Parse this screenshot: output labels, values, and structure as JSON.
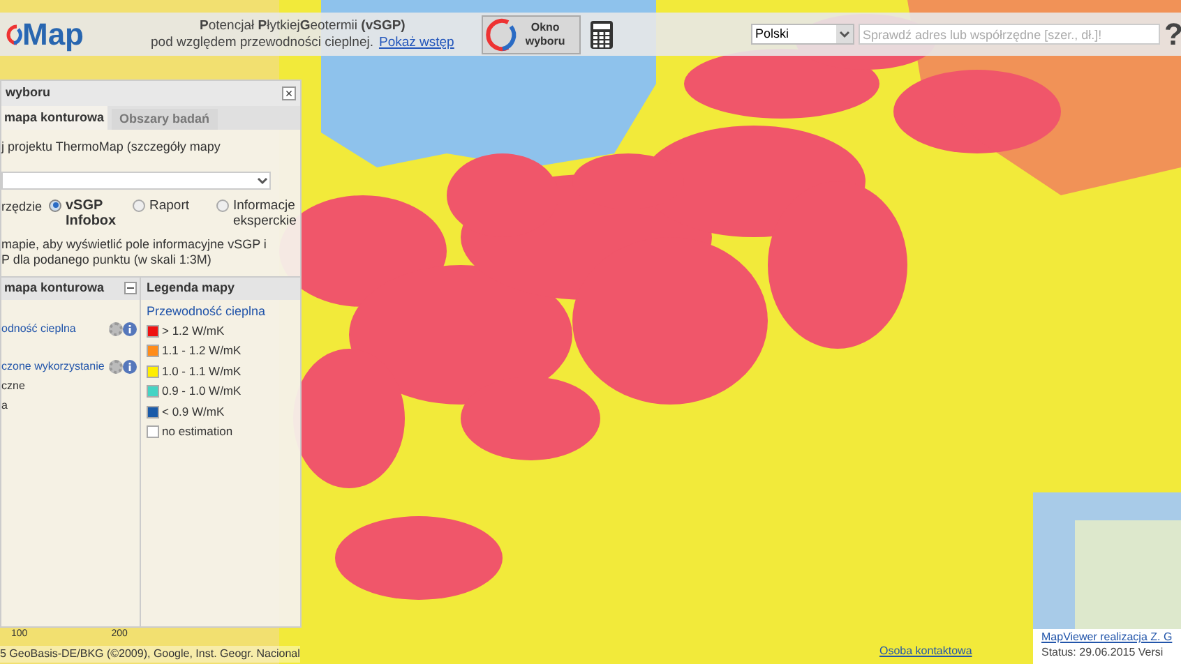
{
  "header": {
    "logo": "Map",
    "title_parts": [
      "P",
      "otencjał ",
      "P",
      "łytkiej",
      "G",
      "eotermii ",
      "(vSGP)"
    ],
    "subtitle": "pod względem przewodności cieplnej.",
    "intro_link": "Pokaż wstęp",
    "select_button": {
      "line1": "Okno",
      "line2": "wyboru"
    },
    "language": "Polski",
    "search": {
      "placeholder": "Sprawdź adres lub współrzędne [szer., dł.]!"
    },
    "help": "?"
  },
  "panel": {
    "title": "wyboru",
    "close": "×",
    "tabs": [
      {
        "label": "mapa konturowa",
        "selected": true
      },
      {
        "label": "Obszary badań",
        "selected": false
      }
    ],
    "description": "j projektu ThermoMap (szczegóły mapy",
    "tool_label": "rzędzie",
    "radios": [
      {
        "label": "vSGP Infobox",
        "selected": true
      },
      {
        "label": "Raport",
        "selected": false
      },
      {
        "label": "Informacje eksperckie",
        "selected": false
      }
    ],
    "hint": "mapie, aby wyświetlić pole informacyjne vSGP i P dla podanego punktu (w skali 1:3M)",
    "layers": {
      "title": "mapa konturowa",
      "items": [
        {
          "label": "odność cieplna",
          "tools": true
        },
        {
          "label": "czone wykorzystanie",
          "tools": true
        },
        {
          "label": "czne",
          "tools": false
        },
        {
          "label": "a",
          "tools": false
        }
      ]
    },
    "legend": {
      "title": "Legenda mapy",
      "subtitle": "Przewodność cieplna",
      "items": [
        {
          "label": "> 1.2 W/mK",
          "color": "#ee1111"
        },
        {
          "label": "1.1 - 1.2 W/mK",
          "color": "#ff8c1a"
        },
        {
          "label": "1.0 - 1.1 W/mK",
          "color": "#ffee00"
        },
        {
          "label": "0.9 - 1.0 W/mK",
          "color": "#44d4c4"
        },
        {
          "label": "< 0.9 W/mK",
          "color": "#1a5aa8"
        },
        {
          "label": "no estimation",
          "color": "#ffffff"
        }
      ]
    }
  },
  "scale": [
    "100",
    "200"
  ],
  "attribution": "5 GeoBasis-DE/BKG (©2009), Google, Inst. Geogr. Nacional",
  "contact_link": "Osoba kontaktowa",
  "footer": {
    "link": "MapViewer realizacja Z. G",
    "status": "Status: 29.06.2015 Versi"
  }
}
